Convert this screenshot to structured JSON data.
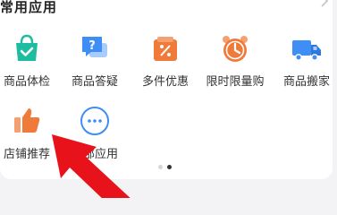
{
  "section": {
    "title": "常用应用",
    "more_icon": "chevron-right-icon"
  },
  "apps": [
    {
      "label": "商品体检",
      "icon": "shopping-bag-check-icon",
      "color": "#1fbda0"
    },
    {
      "label": "商品答疑",
      "icon": "question-chat-icon",
      "color": "#3e8ef5"
    },
    {
      "label": "多件优惠",
      "icon": "discount-box-icon",
      "color": "#f07a3a"
    },
    {
      "label": "限时限量购",
      "icon": "alarm-clock-icon",
      "color": "#f07a3a"
    },
    {
      "label": "商品搬家",
      "icon": "moving-truck-icon",
      "color": "#3e8ef5"
    },
    {
      "label": "店铺推荐",
      "icon": "thumbs-up-icon",
      "color": "#f07a3a"
    },
    {
      "label": "全部应用",
      "icon": "more-dots-icon",
      "color": "#3e8ef5"
    }
  ],
  "pager": {
    "current_page": 2,
    "total_pages": 2
  },
  "annotation": {
    "icon": "red-pointer-arrow-icon",
    "color": "#e8131a"
  }
}
